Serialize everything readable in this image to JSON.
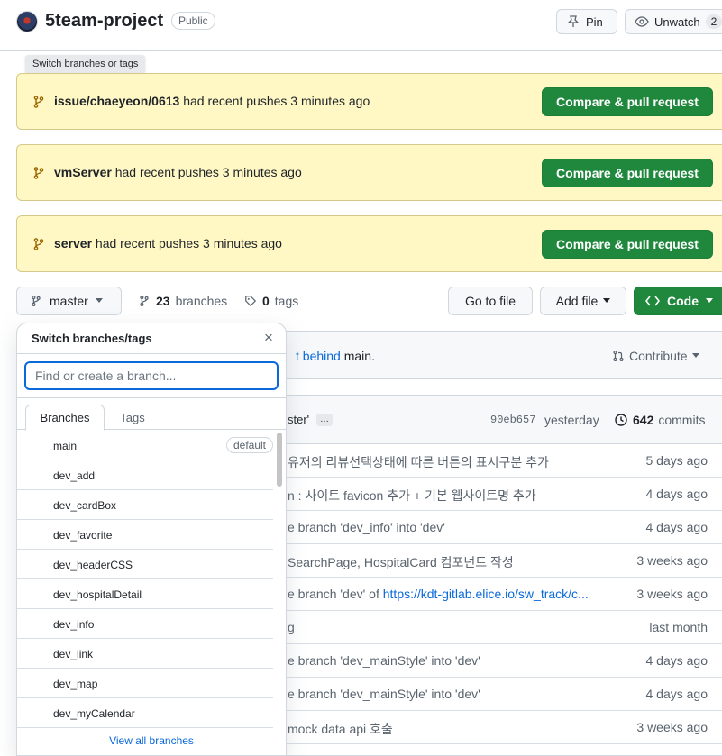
{
  "header": {
    "repo_name": "5team-project",
    "visibility": "Public",
    "pin_label": "Pin",
    "watch_label": "Unwatch",
    "watch_count": "2"
  },
  "tooltip": "Switch branches or tags",
  "banners": [
    {
      "branch": "issue/chaeyeon/0613",
      "text": " had recent pushes 3 minutes ago",
      "button": "Compare & pull request"
    },
    {
      "branch": "vmServer",
      "text": " had recent pushes 3 minutes ago",
      "button": "Compare & pull request"
    },
    {
      "branch": "server",
      "text": " had recent pushes 3 minutes ago",
      "button": "Compare & pull request"
    }
  ],
  "branch_bar": {
    "current_branch": "master",
    "branches_count": "23",
    "branches_label": "branches",
    "tags_count": "0",
    "tags_label": "tags",
    "go_to_file": "Go to file",
    "add_file": "Add file",
    "code": "Code"
  },
  "compare": {
    "link_text": "t behind",
    "rest_text": " main.",
    "contribute": "Contribute"
  },
  "latest_commit": {
    "message": "ster'",
    "ellipsis": "…",
    "sha": "90eb657",
    "when": "yesterday",
    "commits_count": "642",
    "commits_label": "commits"
  },
  "commit_rows": [
    {
      "msg": "유저의 리뷰선택상태에 따른 버튼의 표시구분 추가",
      "link": "",
      "age": "5 days ago"
    },
    {
      "msg": "n : 사이트 favicon 추가 + 기본 웹사이트명 추가",
      "link": "",
      "age": "4 days ago"
    },
    {
      "msg": "e branch 'dev_info' into 'dev'",
      "link": "",
      "age": "4 days ago"
    },
    {
      "msg": "SearchPage, HospitalCard 컴포넌트 작성",
      "link": "",
      "age": "3 weeks ago"
    },
    {
      "msg": "e branch 'dev' of ",
      "link": "https://kdt-gitlab.elice.io/sw_track/c...",
      "age": "3 weeks ago"
    },
    {
      "msg": "g",
      "link": "",
      "age": "last month"
    },
    {
      "msg": "e branch 'dev_mainStyle' into 'dev'",
      "link": "",
      "age": "4 days ago"
    },
    {
      "msg": "e branch 'dev_mainStyle' into 'dev'",
      "link": "",
      "age": "4 days ago"
    },
    {
      "msg": "mock data api 호출",
      "link": "",
      "age": "3 weeks ago"
    }
  ],
  "dropdown": {
    "title": "Switch branches/tags",
    "close_icon": "×",
    "placeholder": "Find or create a branch...",
    "tab_branches": "Branches",
    "tab_tags": "Tags",
    "default_badge": "default",
    "branches": [
      "main",
      "dev_add",
      "dev_cardBox",
      "dev_favorite",
      "dev_headerCSS",
      "dev_hospitalDetail",
      "dev_info",
      "dev_link",
      "dev_map",
      "dev_myCalendar"
    ],
    "view_all": "View all branches"
  },
  "colors": {
    "primary_green": "#1f883d",
    "banner_bg": "#fff8c5",
    "link_blue": "#0969da",
    "border": "#d0d7de"
  },
  "icons": [
    "pin-icon",
    "eye-icon",
    "git-branch-icon",
    "tag-icon",
    "code-icon",
    "git-pull-request-icon",
    "history-icon",
    "close-icon",
    "caret-down-icon"
  ]
}
